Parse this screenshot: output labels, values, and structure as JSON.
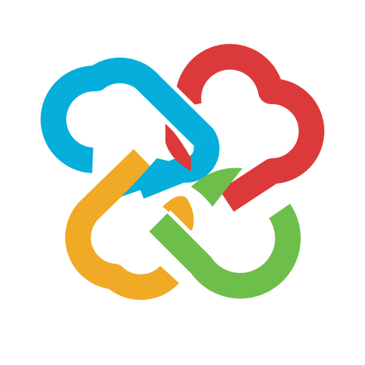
{
  "logo": {
    "icon": "interlocking-links-logo-icon",
    "colors": {
      "background": "#ffffff",
      "gap": "#ffffff",
      "blue": "#06AEDB",
      "red": "#DC3A3A",
      "orange": "#F0AA26",
      "green": "#6DBE4A"
    }
  }
}
